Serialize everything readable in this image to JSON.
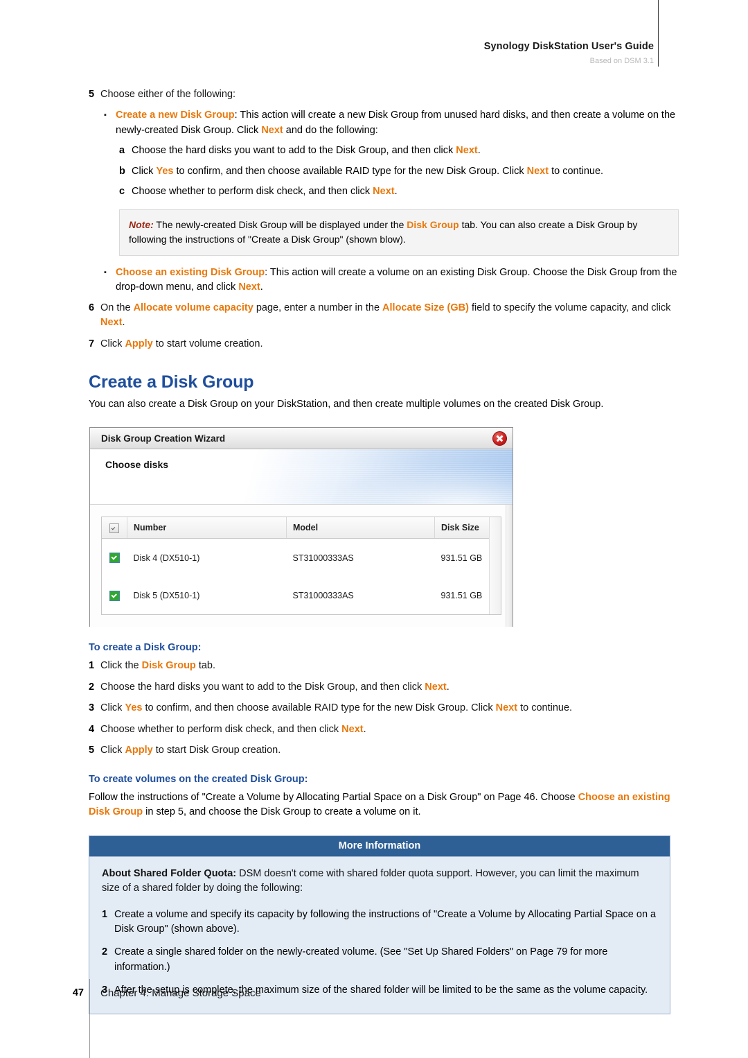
{
  "header": {
    "title": "Synology DiskStation User's Guide",
    "subtitle": "Based on DSM 3.1"
  },
  "steps_top": {
    "s5_num": "5",
    "s5_text": "Choose either of the following:",
    "bullet1_label": "Create a new Disk Group",
    "bullet1_text_a": ": This action will create a new Disk Group from unused hard disks, and then create a volume on the newly-created Disk Group. Click ",
    "bullet1_next": "Next",
    "bullet1_text_b": " and do the following:",
    "a_letter": "a",
    "a_text_a": "Choose the hard disks you want to add to the Disk Group, and then click ",
    "a_next": "Next",
    "a_text_b": ".",
    "b_letter": "b",
    "b_text_a": "Click ",
    "b_yes": "Yes",
    "b_text_b": " to confirm, and then choose available RAID type for the new Disk Group. Click ",
    "b_next": "Next",
    "b_text_c": " to continue.",
    "c_letter": "c",
    "c_text_a": "Choose whether to perform disk check, and then click ",
    "c_next": "Next",
    "c_text_b": "."
  },
  "note": {
    "label": "Note:",
    "text_a": " The newly-created Disk Group will be displayed under the ",
    "disk_group": "Disk Group",
    "text_b": " tab. You can also create a Disk Group by following the instructions of \"Create a Disk Group\" (shown blow)."
  },
  "bullet2": {
    "label": "Choose an existing Disk Group",
    "text_a": ": This action will create a volume on an existing Disk Group. Choose the Disk Group from the drop-down menu, and click ",
    "next": "Next",
    "text_b": "."
  },
  "steps_mid": {
    "s6_num": "6",
    "s6_text_a": "On the ",
    "s6_hl1": "Allocate volume capacity",
    "s6_text_b": " page, enter a number in the ",
    "s6_hl2": "Allocate Size (GB)",
    "s6_text_c": " field to specify the volume capacity, and click ",
    "s6_next": "Next",
    "s6_text_d": ".",
    "s7_num": "7",
    "s7_text_a": "Click ",
    "s7_apply": "Apply",
    "s7_text_b": " to start volume creation."
  },
  "section": {
    "heading": "Create a Disk Group",
    "intro": "You can also create a Disk Group on your DiskStation, and then create multiple volumes on the created Disk Group."
  },
  "wizard": {
    "title": "Disk Group Creation Wizard",
    "close_icon": "close-icon",
    "step_title": "Choose disks",
    "columns": [
      "",
      "Number",
      "Model",
      "Disk Size"
    ],
    "rows": [
      {
        "checked": true,
        "number": "Disk 4 (DX510-1)",
        "model": "ST31000333AS",
        "size": "931.51 GB"
      },
      {
        "checked": true,
        "number": "Disk 5 (DX510-1)",
        "model": "ST31000333AS",
        "size": "931.51 GB"
      }
    ]
  },
  "create_group": {
    "heading": "To create a Disk Group:",
    "s1_num": "1",
    "s1_text_a": "Click the ",
    "s1_hl": "Disk Group",
    "s1_text_b": " tab.",
    "s2_num": "2",
    "s2_text_a": "Choose the hard disks you want to add to the Disk Group, and then click ",
    "s2_next": "Next",
    "s2_text_b": ".",
    "s3_num": "3",
    "s3_text_a": "Click ",
    "s3_yes": "Yes",
    "s3_text_b": " to confirm, and then choose available RAID type for the new Disk Group. Click ",
    "s3_next": "Next",
    "s3_text_c": " to continue.",
    "s4_num": "4",
    "s4_text_a": "Choose whether to perform disk check, and then click ",
    "s4_next": "Next",
    "s4_text_b": ".",
    "s5_num": "5",
    "s5_text_a": "Click ",
    "s5_apply": "Apply",
    "s5_text_b": " to start Disk Group creation."
  },
  "create_volumes": {
    "heading": "To create volumes on the created Disk Group:",
    "text_a": "Follow the instructions of \"Create a Volume by Allocating Partial Space on a Disk Group\" on Page 46. Choose ",
    "hl": "Choose an existing Disk Group",
    "text_b": " in step 5, and choose the Disk Group to create a volume on it."
  },
  "more_info": {
    "header": "More Information",
    "lead_label": "About Shared Folder Quota:",
    "lead_text": " DSM doesn't come with shared folder quota support. However, you can limit the maximum size of a shared folder by doing the following:",
    "s1_num": "1",
    "s1_text": "Create a volume and specify its capacity by following the instructions of \"Create a Volume by Allocating Partial Space on a Disk Group\" (shown above).",
    "s2_num": "2",
    "s2_text": "Create a single shared folder on the newly-created volume. (See \"Set Up Shared Folders\" on Page 79 for more information.)",
    "s3_num": "3",
    "s3_text": "After the setup is complete, the maximum size of the shared folder will be limited to be the same as the volume capacity."
  },
  "footer": {
    "page_number": "47",
    "chapter": "Chapter 4: Manage Storage Space"
  },
  "colors": {
    "accent_orange": "#E8780C",
    "heading_blue": "#1F4E9C",
    "info_header_blue": "#2E5F95",
    "note_red": "#9C2B18"
  }
}
